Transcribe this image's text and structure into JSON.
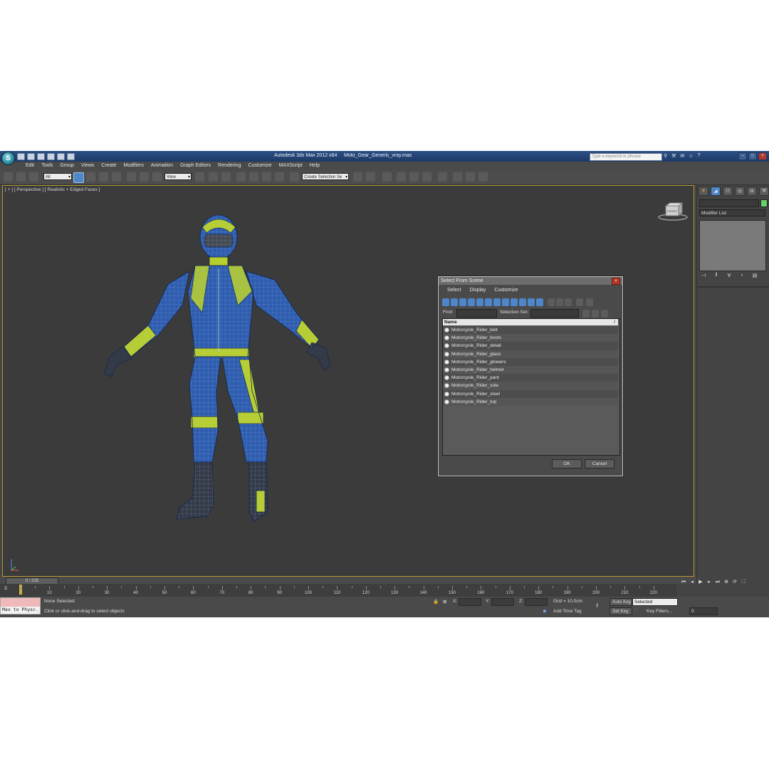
{
  "window": {
    "app_title": "Autodesk 3ds Max  2012 x64",
    "file_name": "Moto_Gear_Generic_vray.max",
    "search_placeholder": "Type a keyword or phrase"
  },
  "menu": [
    "Edit",
    "Tools",
    "Group",
    "Views",
    "Create",
    "Modifiers",
    "Animation",
    "Graph Editors",
    "Rendering",
    "Customize",
    "MAXScript",
    "Help"
  ],
  "toolbar": {
    "selection_filter": "All",
    "reference_coord": "View",
    "named_selection": "Create Selection Se"
  },
  "viewport": {
    "label": "[ + ] [ Perspective ] [ Realistic + Edged Faces ]",
    "viewcube_label": "FRONT"
  },
  "command_panel": {
    "modifier_list": "Modifier List"
  },
  "dialog": {
    "title": "Select From Scene",
    "menu": [
      "Select",
      "Display",
      "Customize"
    ],
    "find_label": "Find:",
    "selection_set_label": "Selection Set:",
    "column_name": "Name",
    "column_sort": "/",
    "items": [
      "Motorcycle_Rider_belt",
      "Motorcycle_Rider_boots",
      "Motorcycle_Rider_detail",
      "Motorcycle_Rider_glass",
      "Motorcycle_Rider_glowers",
      "Motorcycle_Rider_helmet",
      "Motorcycle_Rider_pant",
      "Motorcycle_Rider_sole",
      "Motorcycle_Rider_steel",
      "Motorcycle_Rider_top"
    ],
    "ok_label": "OK",
    "cancel_label": "Cancel"
  },
  "timeline": {
    "slider_label": "0 / 225",
    "ticks": [
      "10",
      "20",
      "30",
      "40",
      "50",
      "60",
      "70",
      "80",
      "90",
      "100",
      "110",
      "120",
      "130",
      "140",
      "150",
      "160",
      "170",
      "180",
      "190",
      "200",
      "210",
      "220"
    ]
  },
  "status": {
    "maxscript_listener": "Max to Physc.",
    "selection_status": "None Selected",
    "prompt": "Click or click-and-drag to select objects",
    "x_label": "X:",
    "y_label": "Y:",
    "z_label": "Z:",
    "grid": "Grid = 10,0cm",
    "add_time_tag": "Add Time Tag",
    "auto_key": "Auto Key",
    "auto_key_mode": "Selected",
    "set_key": "Set Key",
    "key_filters": "Key Filters...",
    "current_frame": "0"
  },
  "colors": {
    "suit_blue": "#2e5db0",
    "suit_lime": "#b7cf2e",
    "viewport_border": "#b89830"
  }
}
